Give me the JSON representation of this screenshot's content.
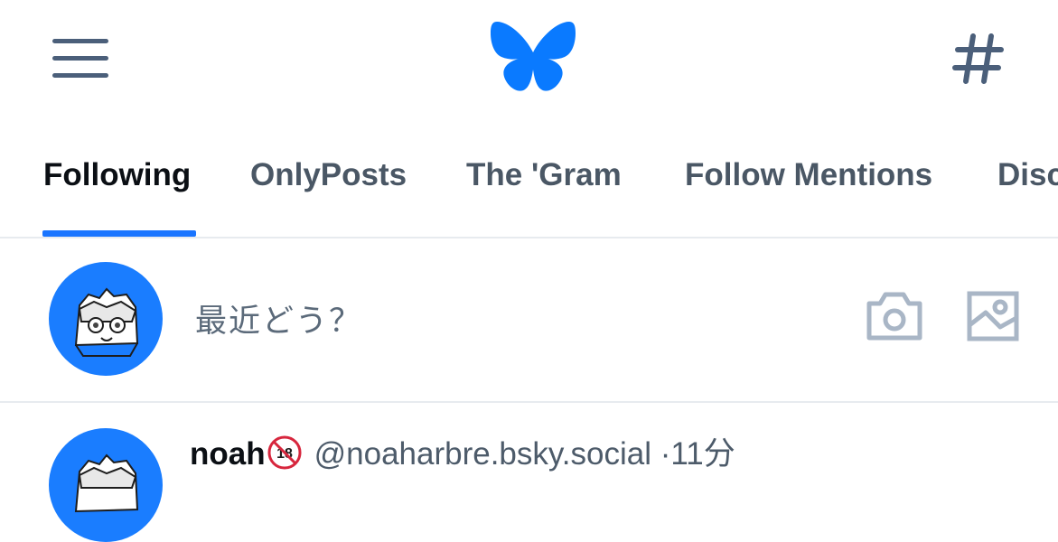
{
  "header": {
    "menu_icon": "hamburger-menu-icon",
    "logo_icon": "butterfly-logo-icon",
    "feeds_icon": "hashtag-icon"
  },
  "tabs": [
    {
      "label": "Following",
      "active": true
    },
    {
      "label": "OnlyPosts",
      "active": false
    },
    {
      "label": "The 'Gram",
      "active": false
    },
    {
      "label": "Follow Mentions",
      "active": false
    },
    {
      "label": "Disc",
      "active": false
    }
  ],
  "composer": {
    "placeholder": "最近どう？",
    "camera_icon": "camera-icon",
    "image_icon": "image-icon"
  },
  "post": {
    "author": "noah",
    "author_badge": "🔞",
    "handle": "@noaharbre.bsky.social",
    "separator": "·",
    "time": "11分"
  },
  "colors": {
    "accent": "#1a75ff",
    "icon": "#4b5f7a",
    "muted_icon": "#a9b6c6"
  }
}
